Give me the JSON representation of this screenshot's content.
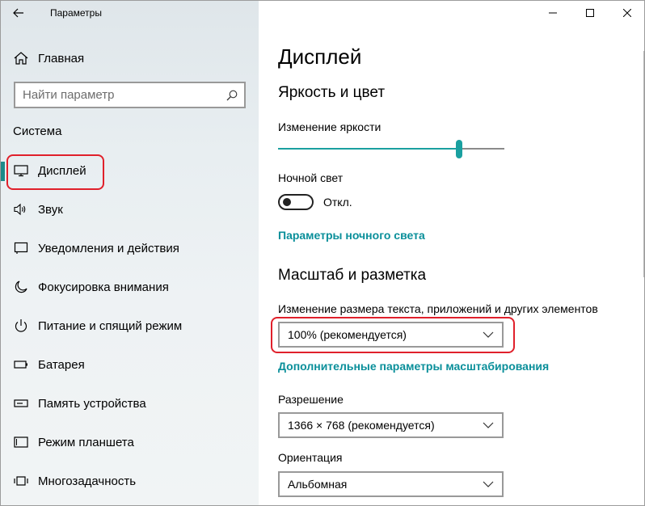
{
  "window": {
    "title": "Параметры",
    "controls": [
      "minimize",
      "maximize",
      "close"
    ]
  },
  "sidebar": {
    "home_label": "Главная",
    "search": {
      "placeholder": "Найти параметр",
      "value": ""
    },
    "section_title": "Система",
    "items": [
      {
        "label": "Дисплей",
        "icon": "monitor-icon",
        "active": true
      },
      {
        "label": "Звук",
        "icon": "speaker-icon"
      },
      {
        "label": "Уведомления и действия",
        "icon": "notification-icon"
      },
      {
        "label": "Фокусировка внимания",
        "icon": "moon-icon"
      },
      {
        "label": "Питание и спящий режим",
        "icon": "power-icon"
      },
      {
        "label": "Батарея",
        "icon": "battery-icon"
      },
      {
        "label": "Память устройства",
        "icon": "storage-icon"
      },
      {
        "label": "Режим планшета",
        "icon": "tablet-icon"
      },
      {
        "label": "Многозадачность",
        "icon": "multitask-icon"
      }
    ]
  },
  "main": {
    "page_title": "Дисплей",
    "brightness": {
      "section_title": "Яркость и цвет",
      "slider_label": "Изменение яркости",
      "level": 0.8
    },
    "night_light": {
      "label": "Ночной свет",
      "toggle_state": "Откл.",
      "settings_link": "Параметры ночного света"
    },
    "scale": {
      "section_title": "Масштаб и разметка",
      "size_label": "Изменение размера текста, приложений и других элементов",
      "size_value": "100% (рекомендуется)",
      "advanced_link": "Дополнительные параметры масштабирования",
      "resolution_label": "Разрешение",
      "resolution_value": "1366 × 768 (рекомендуется)",
      "orientation_label": "Ориентация",
      "orientation_value": "Альбомная"
    }
  },
  "colors": {
    "accent": "#1aa0a0",
    "link": "#0a8f9a",
    "highlight": "#e0202b"
  }
}
